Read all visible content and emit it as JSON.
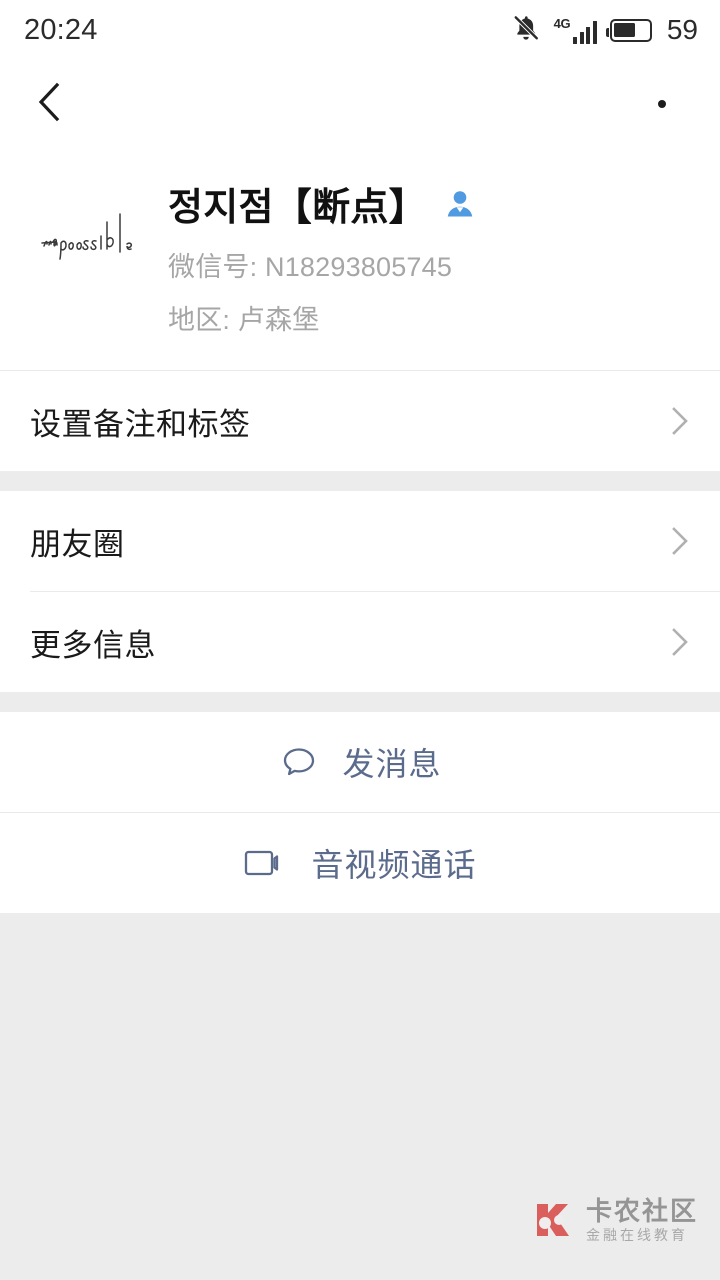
{
  "status_bar": {
    "time": "20:24",
    "network_label": "4G",
    "battery_percent": "59",
    "icons": [
      "mute-bell-icon",
      "signal-4g-icon",
      "battery-icon"
    ]
  },
  "nav": {
    "back_icon": "chevron-left-icon",
    "more_icon": "more-options-icon"
  },
  "profile": {
    "avatar_alt": "impossible",
    "display_name": "정지점【断点】",
    "gender_badge": "male-person-icon",
    "wechat_id_line": "微信号: N18293805745",
    "region_line": "地区: 卢森堡"
  },
  "sections": [
    {
      "rows": [
        {
          "label": "设置备注和标签",
          "name": "row-set-remark-tags"
        }
      ]
    },
    {
      "rows": [
        {
          "label": "朋友圈",
          "name": "row-moments"
        },
        {
          "label": "更多信息",
          "name": "row-more-info"
        }
      ]
    }
  ],
  "actions": [
    {
      "label": "发消息",
      "icon": "chat-bubble-icon",
      "name": "send-message-button"
    },
    {
      "label": "音视频通话",
      "icon": "video-camera-icon",
      "name": "video-call-button"
    }
  ],
  "watermark": {
    "title": "卡农社区",
    "subtitle": "金融在线教育",
    "mark_color": "#d9534f"
  },
  "colors": {
    "page_bg": "#ececec",
    "card_bg": "#ffffff",
    "accent_link": "#5b6b8c",
    "muted_text": "#a6a6a6",
    "primary_text": "#111111",
    "chevron": "#b0b0b0"
  }
}
